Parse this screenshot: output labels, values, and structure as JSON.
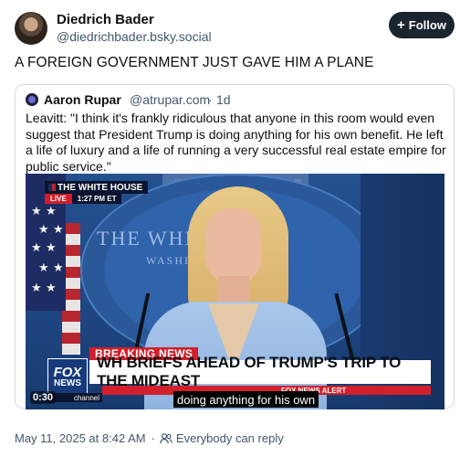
{
  "post": {
    "author": {
      "display_name": "Diedrich Bader",
      "handle": "@diedrichbader.bsky.social",
      "avatar_icon": "user-avatar"
    },
    "follow_label": "Follow",
    "text": "A FOREIGN GOVERNMENT JUST GAVE HIM A PLANE",
    "timestamp": "May 11, 2025 at 8:42 AM",
    "reply_setting": "Everybody can reply"
  },
  "quote": {
    "author": {
      "display_name": "Aaron Rupar",
      "handle": "@atrupar.com",
      "dot": "·",
      "time": "1d"
    },
    "text": "Leavitt: \"I think it's frankly ridiculous that anyone in this room would even suggest that President Trump is doing anything for his own benefit. He left a life of luxury and a life of running a very successful real estate empire for public service.\"",
    "video": {
      "wh_label": "THE WHITE HOUSE",
      "live_label": "LIVE",
      "live_time": "1:27 PM ET",
      "breaking_label": "BREAKING NEWS",
      "headline": "WH BRIEFS AHEAD OF TRUMP'S TRIP TO THE MIDEAST",
      "fox_line1": "FOX",
      "fox_line2": "NEWS",
      "channel_text": "channel",
      "alert_text": "FOX NEWS ALERT",
      "caption": "doing anything for his own",
      "duration": "0:30",
      "backdrop_line1": "THE WHITE",
      "backdrop_line2": "WASHI"
    }
  },
  "colors": {
    "follow_bg": "#1b2530",
    "secondary_text": "#42576c",
    "card_border": "#d4dbe2",
    "breaking_red": "#d11f2b",
    "fox_blue": "#163a7a"
  }
}
